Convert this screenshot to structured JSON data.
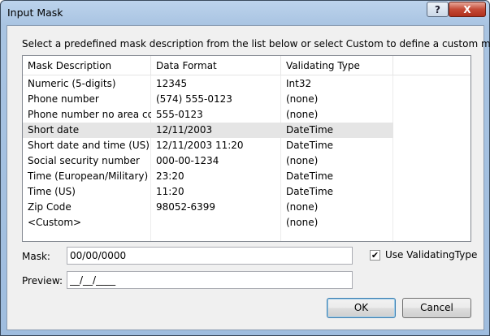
{
  "window": {
    "title": "Input Mask",
    "help_glyph": "?",
    "close_glyph": "X"
  },
  "instruction": "Select a predefined mask description from the list below or select Custom to define a custom mask.",
  "list": {
    "columns": [
      "Mask Description",
      "Data Format",
      "Validating Type"
    ],
    "selected_index": 3,
    "rows": [
      [
        "Numeric (5-digits)",
        "12345",
        "Int32"
      ],
      [
        "Phone number",
        "(574) 555-0123",
        "(none)"
      ],
      [
        "Phone number no area co...",
        "555-0123",
        "(none)"
      ],
      [
        "Short date",
        "12/11/2003",
        "DateTime"
      ],
      [
        "Short date and time (US)",
        "12/11/2003 11:20",
        "DateTime"
      ],
      [
        "Social security number",
        "000-00-1234",
        "(none)"
      ],
      [
        "Time (European/Military)",
        "23:20",
        "DateTime"
      ],
      [
        "Time (US)",
        "11:20",
        "DateTime"
      ],
      [
        "Zip Code",
        "98052-6399",
        "(none)"
      ],
      [
        "<Custom>",
        "",
        "(none)"
      ]
    ]
  },
  "mask": {
    "label": "Mask:",
    "value": "00/00/0000"
  },
  "preview": {
    "label": "Preview:",
    "value": "__/__/____"
  },
  "use_validating_type": {
    "label": "Use ValidatingType",
    "checked": true,
    "check_glyph": "✔"
  },
  "buttons": {
    "ok": "OK",
    "cancel": "Cancel"
  }
}
